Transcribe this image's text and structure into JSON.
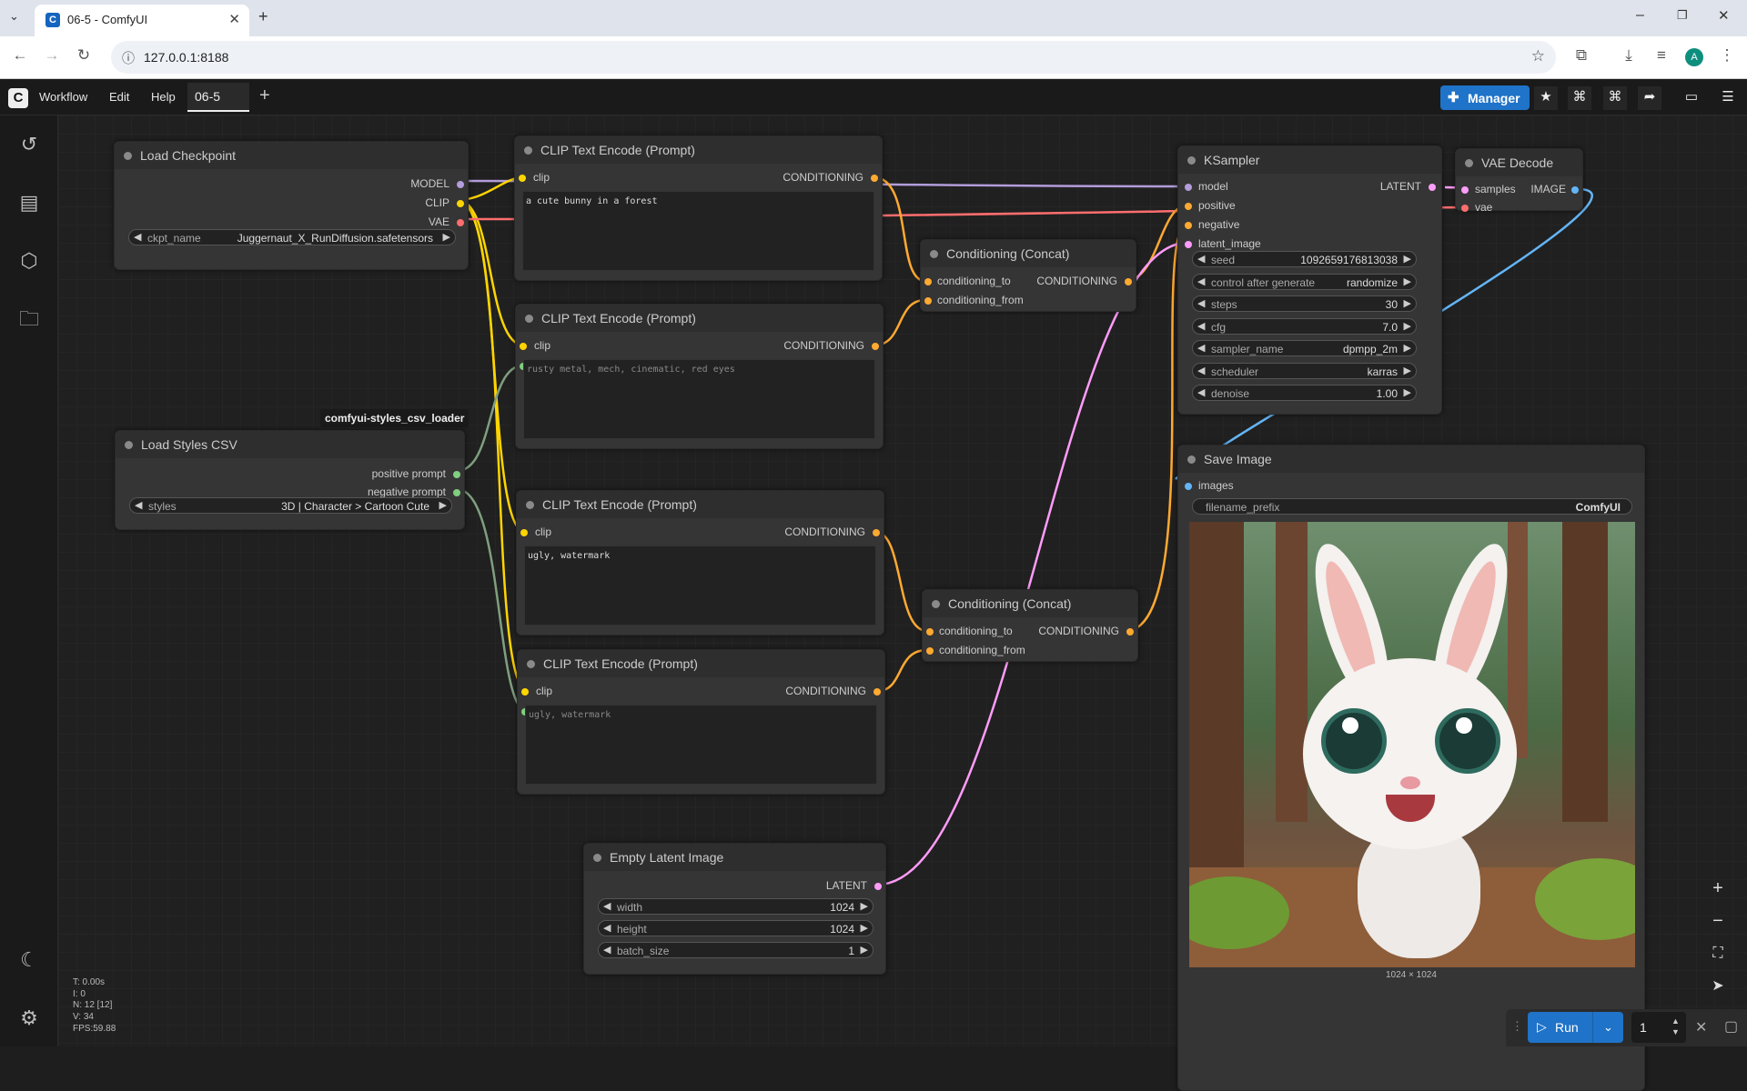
{
  "browser": {
    "tab_title": "06-5 - ComfyUI",
    "url": "127.0.0.1:8188",
    "profile_initial": "A"
  },
  "topbar": {
    "menu": [
      "Workflow",
      "Edit",
      "Help"
    ],
    "workflow_tab": "06-5",
    "manager_label": "Manager"
  },
  "badge": "comfyui-styles_csv_loader",
  "nodes": {
    "load_checkpoint": {
      "title": "Load Checkpoint",
      "outputs": [
        "MODEL",
        "CLIP",
        "VAE"
      ],
      "ckpt_label": "ckpt_name",
      "ckpt_value": "Juggernaut_X_RunDiffusion.safetensors"
    },
    "load_styles": {
      "title": "Load Styles CSV",
      "outputs": [
        "positive prompt",
        "negative prompt"
      ],
      "styles_label": "styles",
      "styles_value": "3D | Character > Cartoon Cute"
    },
    "clip1": {
      "title": "CLIP Text Encode (Prompt)",
      "input": "clip",
      "output": "CONDITIONING",
      "text": "a cute bunny in a forest"
    },
    "clip2": {
      "title": "CLIP Text Encode (Prompt)",
      "input": "clip",
      "output": "CONDITIONING",
      "text": "rusty metal, mech, cinematic, red eyes"
    },
    "clip3": {
      "title": "CLIP Text Encode (Prompt)",
      "input": "clip",
      "output": "CONDITIONING",
      "text": "ugly, watermark"
    },
    "clip4": {
      "title": "CLIP Text Encode (Prompt)",
      "input": "clip",
      "output": "CONDITIONING",
      "text": "ugly, watermark"
    },
    "concat1": {
      "title": "Conditioning (Concat)",
      "in1": "conditioning_to",
      "in2": "conditioning_from",
      "output": "CONDITIONING"
    },
    "concat2": {
      "title": "Conditioning (Concat)",
      "in1": "conditioning_to",
      "in2": "conditioning_from",
      "output": "CONDITIONING"
    },
    "empty_latent": {
      "title": "Empty Latent Image",
      "output": "LATENT",
      "widgets": [
        {
          "label": "width",
          "value": "1024"
        },
        {
          "label": "height",
          "value": "1024"
        },
        {
          "label": "batch_size",
          "value": "1"
        }
      ]
    },
    "ksampler": {
      "title": "KSampler",
      "inputs": [
        "model",
        "positive",
        "negative",
        "latent_image"
      ],
      "output": "LATENT",
      "widgets": [
        {
          "label": "seed",
          "value": "1092659176813038"
        },
        {
          "label": "control after generate",
          "value": "randomize"
        },
        {
          "label": "steps",
          "value": "30"
        },
        {
          "label": "cfg",
          "value": "7.0"
        },
        {
          "label": "sampler_name",
          "value": "dpmpp_2m"
        },
        {
          "label": "scheduler",
          "value": "karras"
        },
        {
          "label": "denoise",
          "value": "1.00"
        }
      ]
    },
    "vae_decode": {
      "title": "VAE Decode",
      "inputs": [
        "samples",
        "vae"
      ],
      "output": "IMAGE"
    },
    "save_image": {
      "title": "Save Image",
      "input": "images",
      "prefix_label": "filename_prefix",
      "prefix_value": "ComfyUI",
      "image_size": "1024 × 1024"
    }
  },
  "stats": [
    "T: 0.00s",
    "I: 0",
    "N: 12 [12]",
    "V: 34",
    "FPS:59.88"
  ],
  "run": {
    "label": "Run",
    "batch": "1"
  },
  "colors": {
    "model": "#b39ddb",
    "clip": "#ffd500",
    "vae": "#ff6e6e",
    "conditioning": "#ffa931",
    "latent": "#ff9cf9",
    "image": "#64b5f6",
    "string": "#7fcf7f",
    "accent": "#1f73c8"
  }
}
